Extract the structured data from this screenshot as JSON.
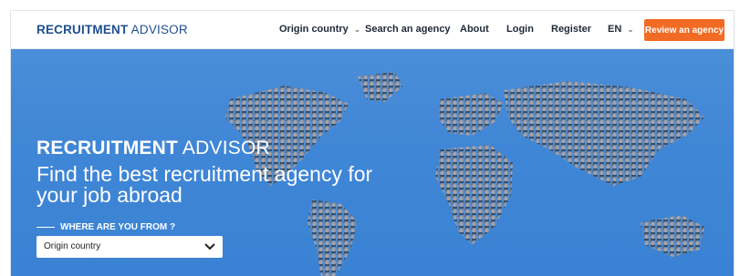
{
  "header": {
    "logo_bold": "RECRUITMENT",
    "logo_light": "ADVISOR",
    "nav": {
      "origin_country": "Origin country",
      "search_agency": "Search an agency",
      "about": "About",
      "login": "Login",
      "register": "Register",
      "language": "EN"
    },
    "cta_label": "Review an agency"
  },
  "hero": {
    "brand_bold": "RECRUITMENT",
    "brand_light": "ADVISOR",
    "title": "Find the best recruitment agency for your job abroad",
    "where_label": "WHERE ARE YOU FROM ?",
    "select_value": "Origin country"
  },
  "colors": {
    "brand_blue": "#1d4f91",
    "hero_blue": "#4189d6",
    "cta_orange": "#f26b24"
  },
  "icons": {
    "nav_dropdown": "chevron-down-icon",
    "select_dropdown": "chevron-down-icon"
  }
}
